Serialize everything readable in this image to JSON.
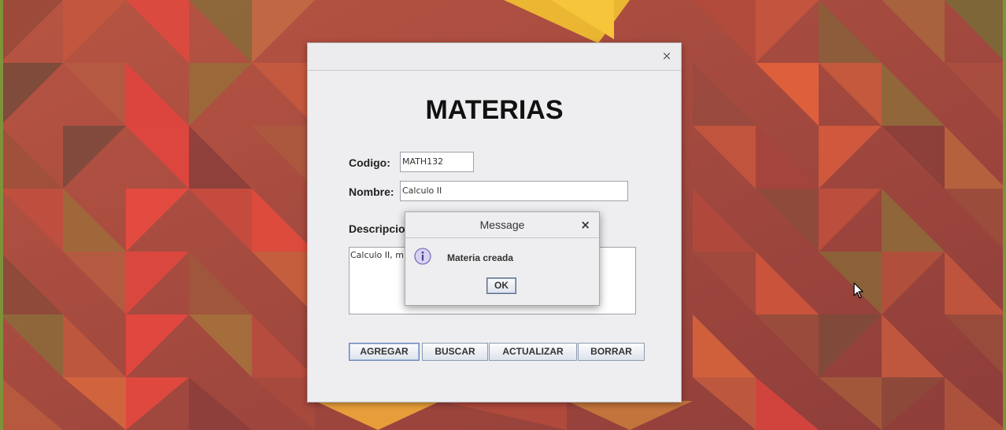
{
  "window": {
    "close_glyph": "×",
    "heading": "MATERIAS"
  },
  "form": {
    "codigo_label": "Codigo:",
    "codigo_value": "MATH132",
    "nombre_label": "Nombre:",
    "nombre_value": "Calculo II",
    "descripcion_label": "Descripcion",
    "descripcion_value": "Calculo II, m"
  },
  "buttons": {
    "agregar": "AGREGAR",
    "buscar": "BUSCAR",
    "actualizar": "ACTUALIZAR",
    "borrar": "BORRAR"
  },
  "dialog": {
    "title": "Message",
    "close_glyph": "×",
    "icon": "info-icon",
    "message": "Materia creada",
    "ok_label": "OK"
  },
  "colors": {
    "accent": "#6c84b8",
    "window_bg": "#eeeef0",
    "background": "#a8453d"
  }
}
